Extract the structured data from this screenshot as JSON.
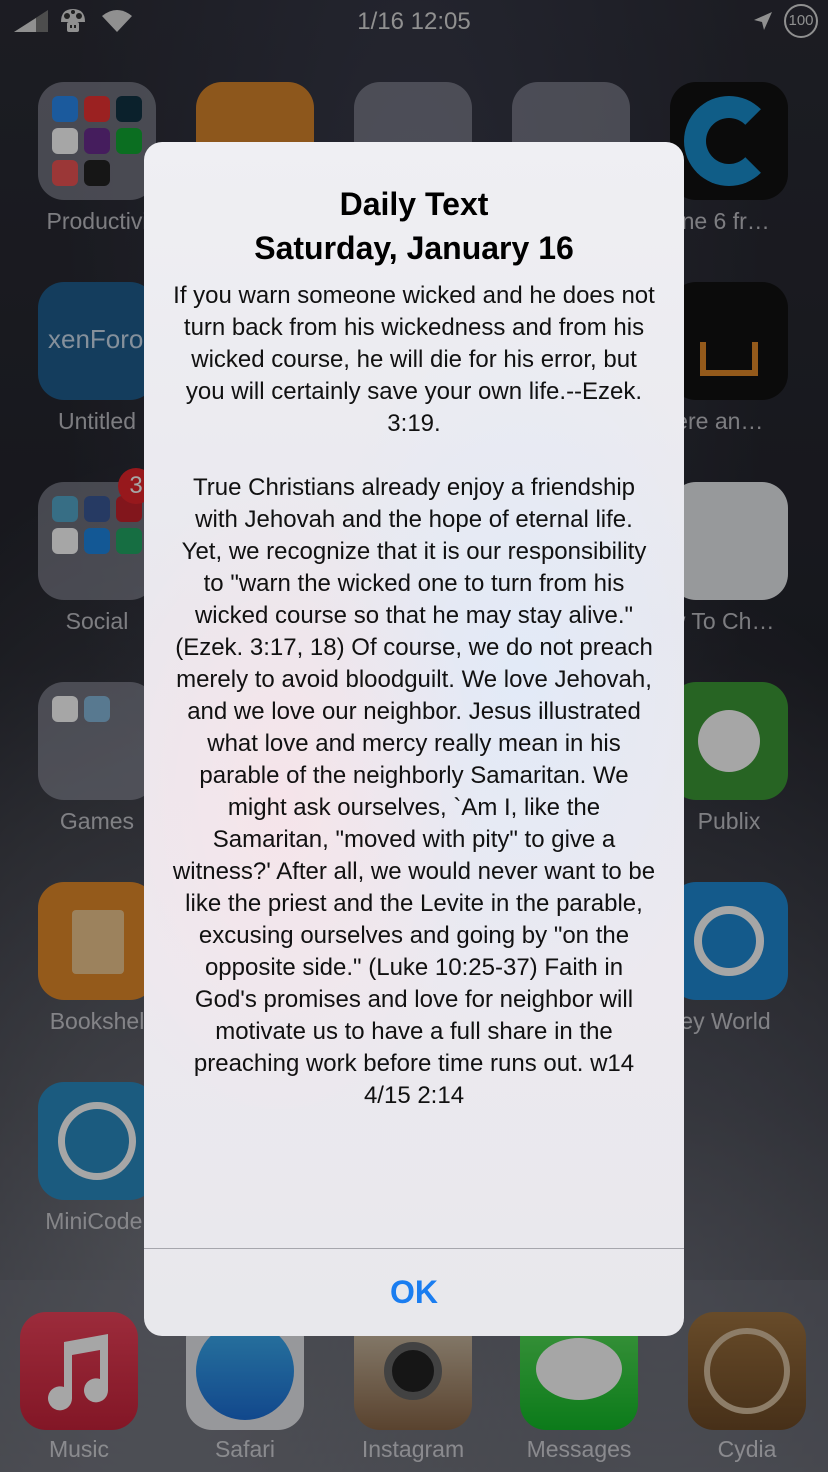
{
  "status_bar": {
    "time": "1/16 12:05",
    "battery": "100"
  },
  "home": {
    "labels": {
      "productivity": "Productivi",
      "untitled": "Untitled",
      "social": "Social",
      "games": "Games",
      "bookshelf": "Bookshel",
      "minicode": "MiniCode.",
      "iphone6": "hone 6 fr…",
      "there": "there an…",
      "howto": "ow To Ch…",
      "publix": "Publix",
      "disney": "sney World"
    },
    "xenforo_text": "xenForo",
    "social_badge": "3"
  },
  "dock": {
    "music": "Music",
    "safari": "Safari",
    "instagram": "Instagram",
    "messages": "Messages",
    "cydia": "Cydia"
  },
  "alert": {
    "title": "Daily Text",
    "subtitle": "Saturday, January 16",
    "body": "If you warn someone wicked and he does not turn back from his wickedness and from his wicked course, he will die for his error, but you will certainly save your own life.--Ezek. 3:19.\n\nTrue Christians already enjoy a friendship with Jehovah and the hope of eternal life. Yet, we recognize that it is our responsibility to \"warn the wicked one to turn from his wicked course so that he may stay alive.\" (Ezek. 3:17, 18) Of course, we do not preach merely to avoid bloodguilt. We love Jehovah, and we love our neighbor. Jesus illustrated what love and mercy really mean in his parable of the neighborly Samaritan. We might ask ourselves, `Am I, like the Samaritan, \"moved with pity\" to give a witness?' After all, we would never want to be like the priest and the Levite in the parable, excusing ourselves and going by \"on the opposite side.\" (Luke 10:25-37) Faith in God's promises and love for neighbor will motivate us to have a full share in the preaching work before time runs out. w14 4/15 2:14",
    "ok_label": "OK"
  },
  "colors": {
    "accent": "#1a7df0",
    "badge": "#e8262b"
  }
}
